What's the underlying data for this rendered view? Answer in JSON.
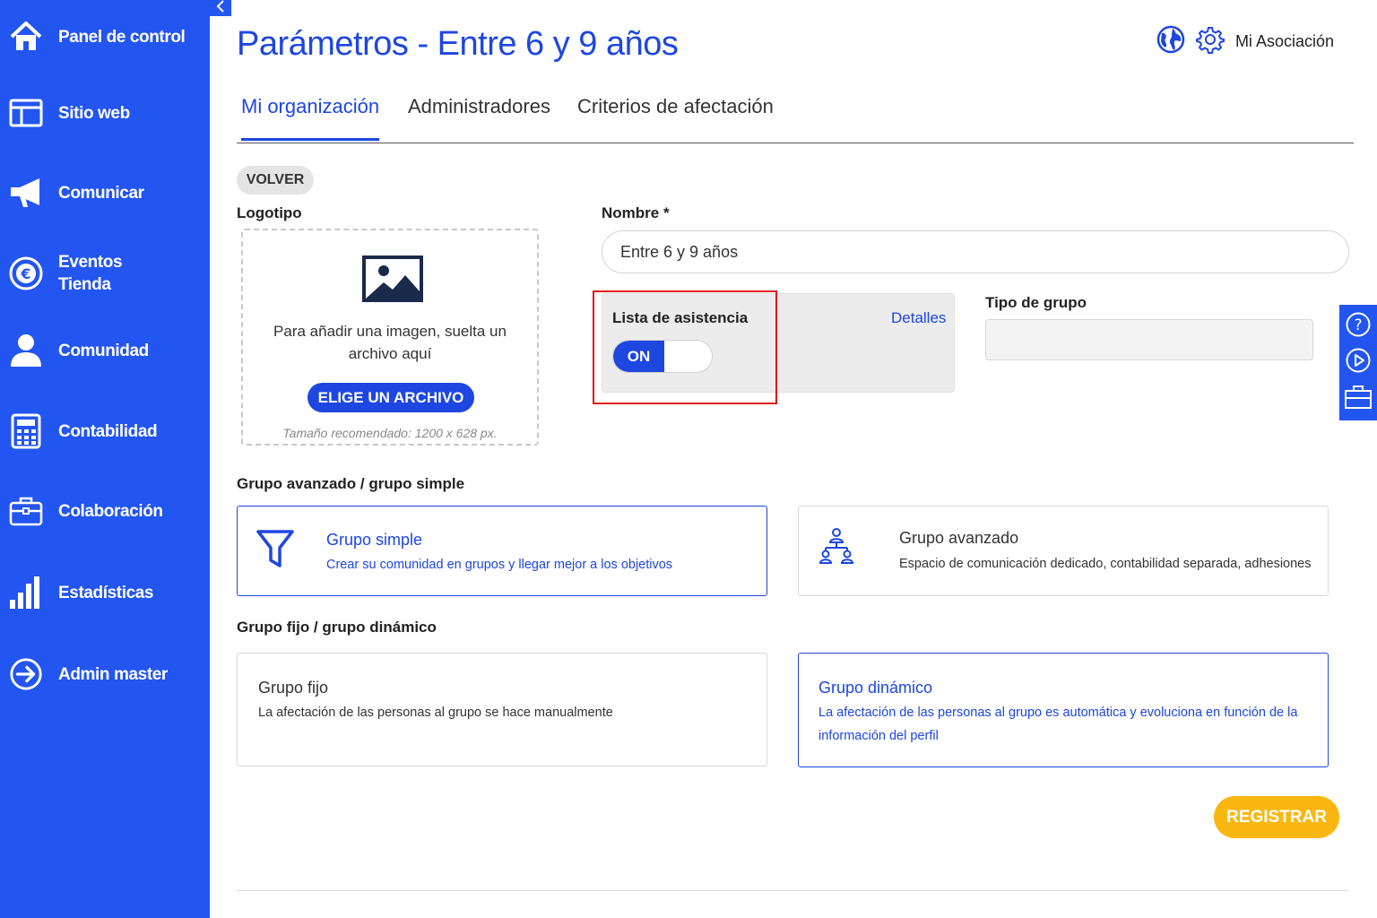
{
  "sidebar": {
    "items": [
      {
        "label": "Panel de control",
        "icon": "home-icon"
      },
      {
        "label": "Sitio web",
        "icon": "website-icon"
      },
      {
        "label": "Comunicar",
        "icon": "megaphone-icon"
      },
      {
        "label": "Eventos\nTienda",
        "icon": "euro-icon"
      },
      {
        "label": "Comunidad",
        "icon": "user-icon"
      },
      {
        "label": "Contabilidad",
        "icon": "calculator-icon"
      },
      {
        "label": "Colaboración",
        "icon": "briefcase-icon"
      },
      {
        "label": "Estadísticas",
        "icon": "bar-chart-icon"
      },
      {
        "label": "Admin master",
        "icon": "arrow-circle-icon"
      }
    ]
  },
  "header": {
    "title": "Parámetros - Entre 6 y 9 años",
    "account": "Mi Asociación"
  },
  "tabs": [
    {
      "label": "Mi organización",
      "active": true
    },
    {
      "label": "Administradores",
      "active": false
    },
    {
      "label": "Criterios de afectación",
      "active": false
    }
  ],
  "form": {
    "back_label": "VOLVER",
    "logo_label": "Logotipo",
    "dropzone_text": "Para añadir una imagen, suelta un archivo aquí",
    "choose_file_label": "ELIGE UN ARCHIVO",
    "size_hint": "Tamaño recomendado: 1200 x 628 px.",
    "name_label": "Nombre *",
    "name_value": "Entre 6 y 9 años",
    "attendance_label": "Lista de asistencia",
    "attendance_toggle": "ON",
    "details_link": "Detalles",
    "group_type_label": "Tipo de grupo",
    "group_type_value": ""
  },
  "sections": {
    "advanced_simple": {
      "heading": "Grupo avanzado / grupo simple",
      "options": [
        {
          "title": "Grupo simple",
          "desc": "Crear su comunidad en grupos y llegar mejor a los objetivos",
          "selected": true
        },
        {
          "title": "Grupo avanzado",
          "desc": "Espacio de comunicación dedicado, contabilidad separada, adhesiones",
          "selected": false
        }
      ]
    },
    "fixed_dynamic": {
      "heading": "Grupo fijo / grupo dinámico",
      "options": [
        {
          "title": "Grupo fijo",
          "desc": "La afectación de las personas al grupo se hace manualmente",
          "selected": false
        },
        {
          "title": "Grupo dinámico",
          "desc": "La afectación de las personas al grupo es automática y evoluciona en función de la información del perfil",
          "selected": true
        }
      ]
    }
  },
  "submit_label": "REGISTRAR",
  "colors": {
    "primary": "#1e46e0",
    "sidebar": "#2355f0",
    "accent": "#fbb711",
    "highlight": "#e0141e"
  }
}
